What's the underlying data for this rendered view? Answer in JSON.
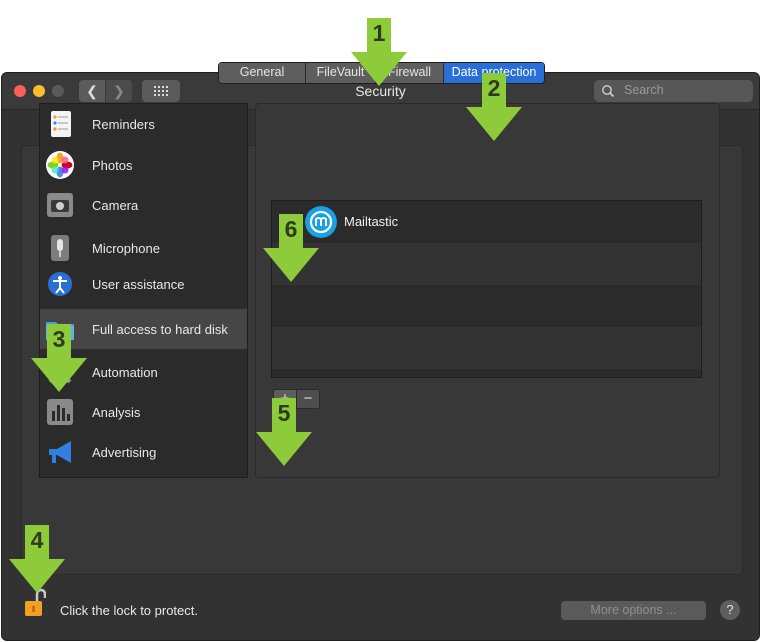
{
  "window": {
    "title": "Security"
  },
  "search": {
    "placeholder": "Search"
  },
  "tabs": [
    {
      "label": "General",
      "selected": false
    },
    {
      "label": "FileVault",
      "selected": false
    },
    {
      "label": "Firewall",
      "selected": false
    },
    {
      "label": "Data protection",
      "selected": true
    }
  ],
  "sidebar": {
    "items": [
      {
        "label": "Reminders",
        "icon": "reminders-icon"
      },
      {
        "label": "Photos",
        "icon": "photos-icon"
      },
      {
        "label": "Camera",
        "icon": "camera-icon"
      },
      {
        "label": "Microphone",
        "icon": "microphone-icon"
      },
      {
        "label": "User assistance",
        "icon": "accessibility-icon"
      },
      {
        "label": "Full access to hard disk",
        "icon": "folder-icon",
        "selected": true
      },
      {
        "label": "Automation",
        "icon": "gear-icon"
      },
      {
        "label": "Analysis",
        "icon": "analytics-icon"
      },
      {
        "label": "Advertising",
        "icon": "megaphone-icon"
      }
    ]
  },
  "apps": [
    {
      "name": "Mailtastic",
      "checked": true,
      "icon": "mailtastic-icon"
    }
  ],
  "controls": {
    "add": "+",
    "remove": "−"
  },
  "footer": {
    "lock_text": "Click the lock to protect.",
    "more_options": "More options ...",
    "help": "?"
  },
  "annotations": [
    "1",
    "2",
    "3",
    "4",
    "5",
    "6"
  ],
  "colors": {
    "accent": "#2a6fd8",
    "annotation": "#8ecb3a",
    "window_bg": "#323232"
  }
}
